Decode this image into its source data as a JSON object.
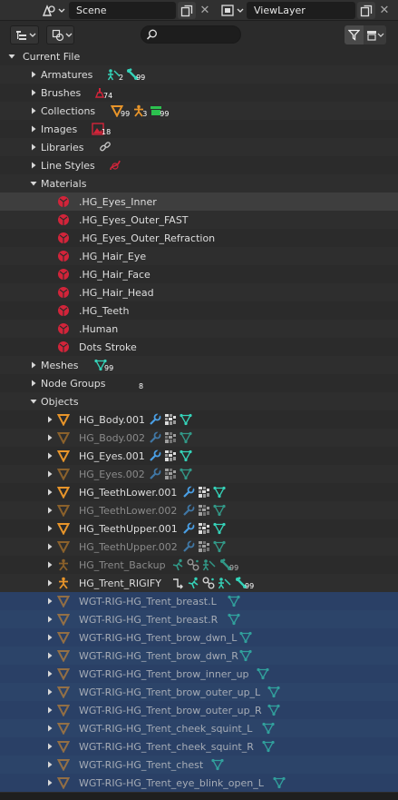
{
  "header": {
    "scene_name": "Scene",
    "view_layer_name": "ViewLayer",
    "scene_icon": "scene-selector-icon",
    "view_layer_icon": "view-layer-icon",
    "copy_icon": "copy-icon",
    "close_icon": "close-icon",
    "close_glyph": "✕"
  },
  "toolbar": {
    "display_mode_icon": "outliner-display-mode-icon",
    "filter_mode_icon": "library-override-filter-icon",
    "search_value": "",
    "search_placeholder": "",
    "filter_icon": "funnel-icon",
    "new_collection_icon": "new-collection-icon"
  },
  "colors": {
    "background": "#2b2b2b",
    "row_alt": "#2e2e2e",
    "row_selected": "#2a4066",
    "material_red": "#d2243a",
    "object_orange": "#e8952a",
    "data_teal": "#35d3b9",
    "modifier_blue": "#4a9fe5",
    "collection_green": "#2cc24f"
  },
  "tree": {
    "rows": [
      {
        "label": "Current File",
        "indent": 0,
        "expanded": true,
        "icon": ""
      },
      {
        "label": "Armatures",
        "indent": 1,
        "expanded": false,
        "subs": [
          {
            "icon": "armature-data-icon",
            "count": "2"
          },
          {
            "icon": "bone-icon",
            "count": "99"
          }
        ]
      },
      {
        "label": "Brushes",
        "indent": 1,
        "expanded": false,
        "subs": [
          {
            "icon": "brush-icon",
            "count": "74"
          }
        ]
      },
      {
        "label": "Collections",
        "indent": 1,
        "expanded": false,
        "subs": [
          {
            "icon": "mesh-object-icon",
            "count": "99"
          },
          {
            "icon": "armature-object-icon",
            "count": "3"
          },
          {
            "icon": "collection-icon",
            "count": "99"
          }
        ]
      },
      {
        "label": "Images",
        "indent": 1,
        "expanded": false,
        "subs": [
          {
            "icon": "image-icon",
            "count": "18"
          }
        ]
      },
      {
        "label": "Libraries",
        "indent": 1,
        "expanded": false,
        "subs": [
          {
            "icon": "link-icon",
            "count": ""
          }
        ]
      },
      {
        "label": "Line Styles",
        "indent": 1,
        "expanded": false,
        "subs": [
          {
            "icon": "linestyle-icon",
            "count": ""
          }
        ]
      },
      {
        "label": "Materials",
        "indent": 1,
        "expanded": true,
        "subs": []
      },
      {
        "label": ".HG_Eyes_Inner",
        "indent": 2,
        "kind": "material",
        "active": true
      },
      {
        "label": ".HG_Eyes_Outer_FAST",
        "indent": 2,
        "kind": "material"
      },
      {
        "label": ".HG_Eyes_Outer_Refraction",
        "indent": 2,
        "kind": "material"
      },
      {
        "label": ".HG_Hair_Eye",
        "indent": 2,
        "kind": "material"
      },
      {
        "label": ".HG_Hair_Face",
        "indent": 2,
        "kind": "material"
      },
      {
        "label": ".HG_Hair_Head",
        "indent": 2,
        "kind": "material"
      },
      {
        "label": ".HG_Teeth",
        "indent": 2,
        "kind": "material"
      },
      {
        "label": ".Human",
        "indent": 2,
        "kind": "material"
      },
      {
        "label": "Dots Stroke",
        "indent": 2,
        "kind": "material"
      },
      {
        "label": "Meshes",
        "indent": 1,
        "expanded": false,
        "subs": [
          {
            "icon": "mesh-data-icon",
            "count": "99"
          }
        ]
      },
      {
        "label": "Node Groups",
        "indent": 1,
        "expanded": false,
        "subs": [
          {
            "icon": "node-group-icon",
            "count": "8"
          }
        ]
      },
      {
        "label": "Objects",
        "indent": 1,
        "expanded": true,
        "subs": []
      },
      {
        "label": "HG_Body.001",
        "indent": 2,
        "kind": "mesh",
        "dim": false,
        "subs": [
          {
            "icon": "modifier-wrench-icon"
          },
          {
            "icon": "vertex-groups-icon"
          },
          {
            "icon": "mesh-data-icon"
          }
        ]
      },
      {
        "label": "HG_Body.002",
        "indent": 2,
        "kind": "mesh",
        "dim": true,
        "subs": [
          {
            "icon": "modifier-wrench-icon"
          },
          {
            "icon": "vertex-groups-icon"
          },
          {
            "icon": "mesh-data-icon"
          }
        ]
      },
      {
        "label": "HG_Eyes.001",
        "indent": 2,
        "kind": "mesh",
        "dim": false,
        "subs": [
          {
            "icon": "modifier-wrench-icon"
          },
          {
            "icon": "vertex-groups-icon"
          },
          {
            "icon": "mesh-data-icon"
          }
        ]
      },
      {
        "label": "HG_Eyes.002",
        "indent": 2,
        "kind": "mesh",
        "dim": true,
        "subs": [
          {
            "icon": "modifier-wrench-icon"
          },
          {
            "icon": "vertex-groups-icon"
          },
          {
            "icon": "mesh-data-icon"
          }
        ]
      },
      {
        "label": "HG_TeethLower.001",
        "indent": 2,
        "kind": "mesh",
        "dim": false,
        "subs": [
          {
            "icon": "modifier-wrench-icon"
          },
          {
            "icon": "vertex-groups-icon"
          },
          {
            "icon": "mesh-data-icon"
          }
        ]
      },
      {
        "label": "HG_TeethLower.002",
        "indent": 2,
        "kind": "mesh",
        "dim": true,
        "subs": [
          {
            "icon": "modifier-wrench-icon"
          },
          {
            "icon": "vertex-groups-icon"
          },
          {
            "icon": "mesh-data-icon"
          }
        ]
      },
      {
        "label": "HG_TeethUpper.001",
        "indent": 2,
        "kind": "mesh",
        "dim": false,
        "subs": [
          {
            "icon": "modifier-wrench-icon"
          },
          {
            "icon": "vertex-groups-icon"
          },
          {
            "icon": "mesh-data-icon"
          }
        ]
      },
      {
        "label": "HG_TeethUpper.002",
        "indent": 2,
        "kind": "mesh",
        "dim": true,
        "subs": [
          {
            "icon": "modifier-wrench-icon"
          },
          {
            "icon": "vertex-groups-icon"
          },
          {
            "icon": "mesh-data-icon"
          }
        ]
      },
      {
        "label": "HG_Trent_Backup",
        "indent": 2,
        "kind": "armature",
        "dim": true,
        "subs": [
          {
            "icon": "pose-icon"
          },
          {
            "icon": "bone-constraint-icon"
          },
          {
            "icon": "armature-data-icon"
          },
          {
            "icon": "bone-icon",
            "count": "99"
          }
        ]
      },
      {
        "label": "HG_Trent_RIGIFY",
        "indent": 2,
        "kind": "armature",
        "dim": false,
        "subs": [
          {
            "icon": "driver-icon"
          },
          {
            "icon": "pose-icon"
          },
          {
            "icon": "bone-constraint-icon"
          },
          {
            "icon": "armature-data-icon"
          },
          {
            "icon": "bone-icon",
            "count": "99"
          }
        ]
      },
      {
        "label": "WGT-RIG-HG_Trent_breast.L",
        "indent": 2,
        "kind": "mesh",
        "selected": true,
        "subs": [
          {
            "icon": "mesh-data-icon"
          }
        ]
      },
      {
        "label": "WGT-RIG-HG_Trent_breast.R",
        "indent": 2,
        "kind": "mesh",
        "selected": true,
        "subs": [
          {
            "icon": "mesh-data-icon"
          }
        ]
      },
      {
        "label": "WGT-RIG-HG_Trent_brow_dwn_L",
        "indent": 2,
        "kind": "mesh",
        "selected": true,
        "subs": [
          {
            "icon": "mesh-data-icon"
          }
        ]
      },
      {
        "label": "WGT-RIG-HG_Trent_brow_dwn_R",
        "indent": 2,
        "kind": "mesh",
        "selected": true,
        "subs": [
          {
            "icon": "mesh-data-icon"
          }
        ]
      },
      {
        "label": "WGT-RIG-HG_Trent_brow_inner_up",
        "indent": 2,
        "kind": "mesh",
        "selected": true,
        "subs": [
          {
            "icon": "mesh-data-icon"
          }
        ]
      },
      {
        "label": "WGT-RIG-HG_Trent_brow_outer_up_L",
        "indent": 2,
        "kind": "mesh",
        "selected": true,
        "subs": [
          {
            "icon": "mesh-data-icon"
          }
        ]
      },
      {
        "label": "WGT-RIG-HG_Trent_brow_outer_up_R",
        "indent": 2,
        "kind": "mesh",
        "selected": true,
        "subs": [
          {
            "icon": "mesh-data-icon"
          }
        ]
      },
      {
        "label": "WGT-RIG-HG_Trent_cheek_squint_L",
        "indent": 2,
        "kind": "mesh",
        "selected": true,
        "subs": [
          {
            "icon": "mesh-data-icon"
          }
        ]
      },
      {
        "label": "WGT-RIG-HG_Trent_cheek_squint_R",
        "indent": 2,
        "kind": "mesh",
        "selected": true,
        "subs": [
          {
            "icon": "mesh-data-icon"
          }
        ]
      },
      {
        "label": "WGT-RIG-HG_Trent_chest",
        "indent": 2,
        "kind": "mesh",
        "selected": true,
        "subs": [
          {
            "icon": "mesh-data-icon"
          }
        ]
      },
      {
        "label": "WGT-RIG-HG_Trent_eye_blink_open_L",
        "indent": 2,
        "kind": "mesh",
        "selected": true,
        "subs": [
          {
            "icon": "mesh-data-icon"
          }
        ]
      }
    ]
  }
}
